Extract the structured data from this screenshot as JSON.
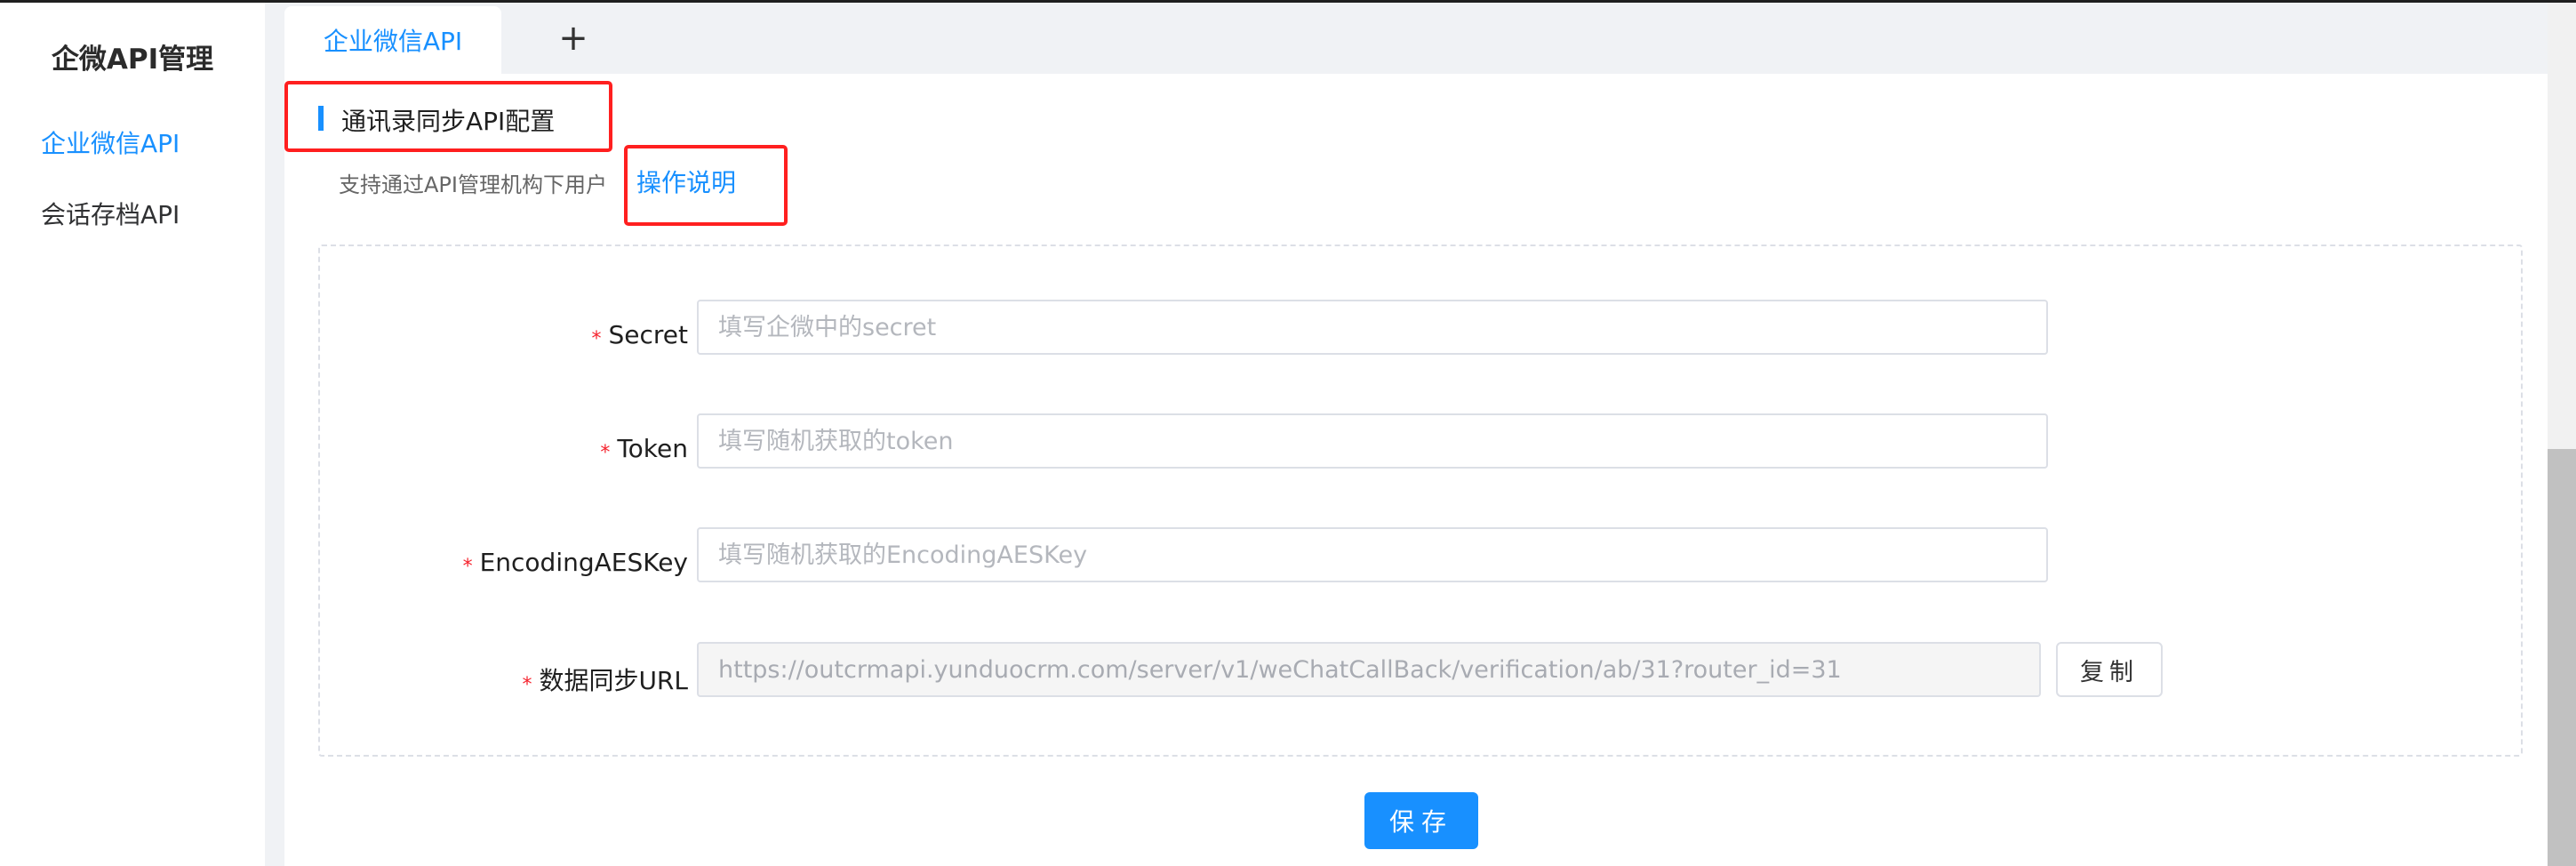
{
  "sidebar": {
    "title": "企微API管理",
    "items": [
      {
        "label": "企业微信API",
        "active": true
      },
      {
        "label": "会话存档API",
        "active": false
      }
    ]
  },
  "tabs": {
    "items": [
      {
        "label": "企业微信API"
      }
    ],
    "add_label": "+"
  },
  "section": {
    "title": "通讯录同步API配置",
    "subtitle": "支持通过API管理机构下用户",
    "help_link": "操作说明"
  },
  "form": {
    "required_mark": "*",
    "fields": [
      {
        "label": "Secret",
        "placeholder": "填写企微中的secret",
        "value": ""
      },
      {
        "label": "Token",
        "placeholder": "填写随机获取的token",
        "value": ""
      },
      {
        "label": "EncodingAESKey",
        "placeholder": "填写随机获取的EncodingAESKey",
        "value": ""
      },
      {
        "label": "数据同步URL",
        "placeholder": "",
        "value": "https://outcrmapi.yunduocrm.com/server/v1/weChatCallBack/verification/ab/31?router_id=31"
      }
    ],
    "copy_label": "复制",
    "save_label": "保存"
  },
  "colors": {
    "accent": "#1890ff",
    "required": "#f5222d",
    "highlight": "#ff1f1f"
  }
}
